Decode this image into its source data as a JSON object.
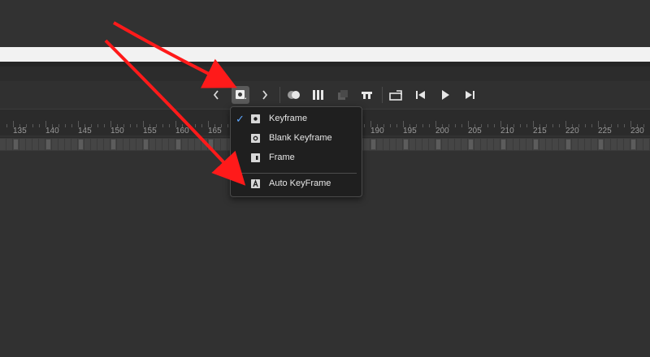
{
  "toolbar": {
    "buttons": [
      {
        "name": "prev-keyframe-icon"
      },
      {
        "name": "insert-keyframe-icon"
      },
      {
        "name": "next-keyframe-icon"
      },
      {
        "name": "onion-skin-icon"
      },
      {
        "name": "frame-view-icon"
      },
      {
        "name": "clone-icon"
      },
      {
        "name": "loop-icon"
      },
      {
        "name": "export-icon"
      },
      {
        "name": "step-back-icon"
      },
      {
        "name": "play-icon"
      },
      {
        "name": "step-forward-icon"
      }
    ]
  },
  "ruler": {
    "labels": [
      "135",
      "140",
      "145",
      "150",
      "155",
      "160",
      "165",
      "190",
      "195",
      "200",
      "205",
      "210",
      "215",
      "220",
      "225",
      "230"
    ]
  },
  "menu": {
    "items": [
      {
        "label": "Keyframe",
        "checked": true,
        "icon": "keyframe-icon"
      },
      {
        "label": "Blank Keyframe",
        "checked": false,
        "icon": "blank-keyframe-icon"
      },
      {
        "label": "Frame",
        "checked": false,
        "icon": "frame-icon"
      },
      {
        "label": "Auto KeyFrame",
        "checked": false,
        "icon": "auto-keyframe-icon"
      }
    ],
    "check_glyph": "✓"
  },
  "colors": {
    "accent_check": "#5ea7ff",
    "annotation_arrow": "#ff1a1a"
  }
}
